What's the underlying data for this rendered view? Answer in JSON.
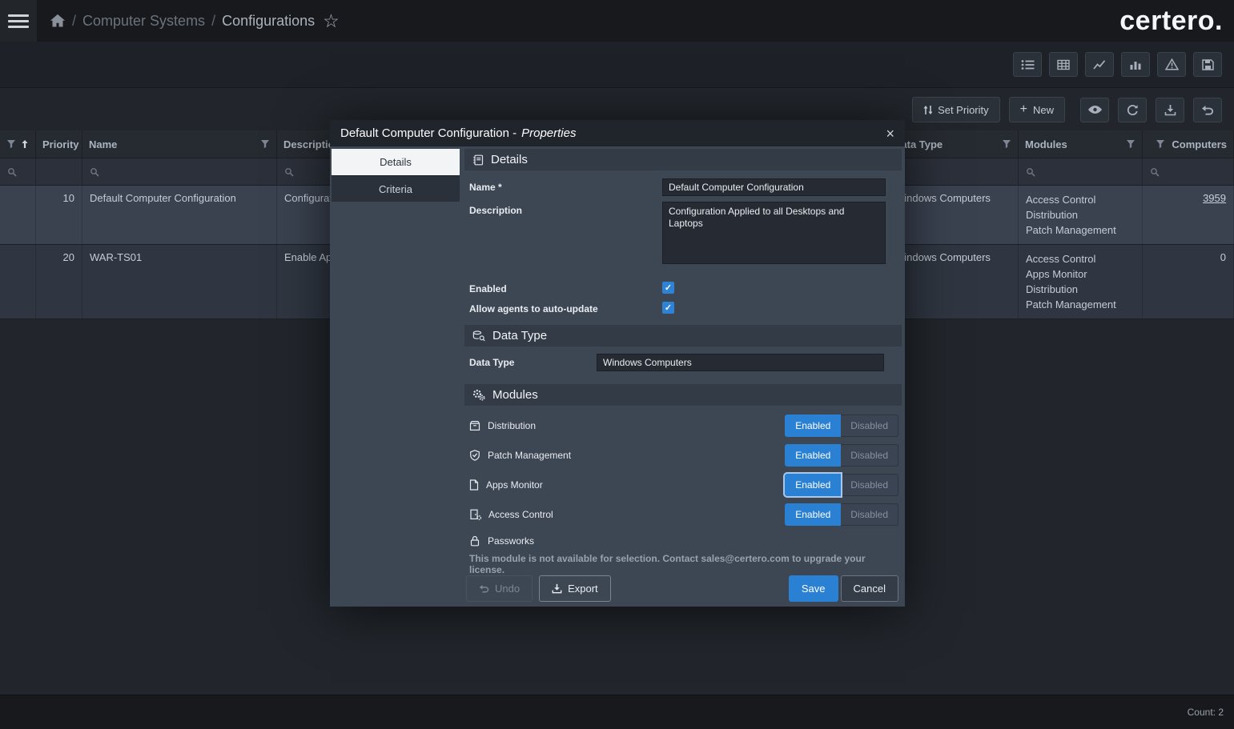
{
  "topbar": {
    "logo": "certero.",
    "breadcrumb": {
      "sep": "/",
      "computer_systems": "Computer Systems",
      "configurations": "Configurations"
    }
  },
  "toolbar": {
    "set_priority_label": "Set Priority",
    "new_label": "New"
  },
  "table": {
    "headers": {
      "priority": "Priority",
      "name": "Name",
      "description": "Description",
      "data_type": "Data Type",
      "modules": "Modules",
      "computers": "Computers"
    },
    "rows": [
      {
        "priority": "10",
        "name": "Default Computer Configuration",
        "description": "Configuration Applied to all Desktops and Laptops",
        "data_type": "Windows Computers",
        "modules": [
          "Access Control",
          "Distribution",
          "Patch Management"
        ],
        "computers": "3959"
      },
      {
        "priority": "20",
        "name": "WAR-TS01",
        "description": "Enable Ap",
        "data_type": "Windows Computers",
        "modules": [
          "Access Control",
          "Apps Monitor",
          "Distribution",
          "Patch Management"
        ],
        "computers": "0"
      }
    ]
  },
  "modal": {
    "title_main": "Default Computer Configuration -",
    "title_em": "Properties",
    "close_glyph": "×",
    "tabs": {
      "details": "Details",
      "criteria": "Criteria"
    },
    "details": {
      "heading": "Details",
      "name_label": "Name *",
      "name_value": "Default Computer Configuration",
      "description_label": "Description",
      "description_value": "Configuration Applied to all Desktops and Laptops",
      "enabled_label": "Enabled",
      "auto_update_label": "Allow agents to auto-update",
      "check_glyph": "✓"
    },
    "data_type": {
      "heading": "Data Type",
      "label": "Data Type",
      "value": "Windows Computers"
    },
    "modules": {
      "heading": "Modules",
      "enabled_label": "Enabled",
      "disabled_label": "Disabled",
      "items": [
        {
          "name": "Distribution"
        },
        {
          "name": "Patch Management"
        },
        {
          "name": "Apps Monitor"
        },
        {
          "name": "Access Control"
        }
      ],
      "locked_name": "Passworks",
      "locked_note": "This module is not available for selection. Contact sales@certero.com to upgrade your license."
    },
    "footer": {
      "undo_label": "Undo",
      "export_label": "Export",
      "save_label": "Save",
      "cancel_label": "Cancel"
    }
  },
  "statusbar": {
    "count": "Count: 2"
  }
}
